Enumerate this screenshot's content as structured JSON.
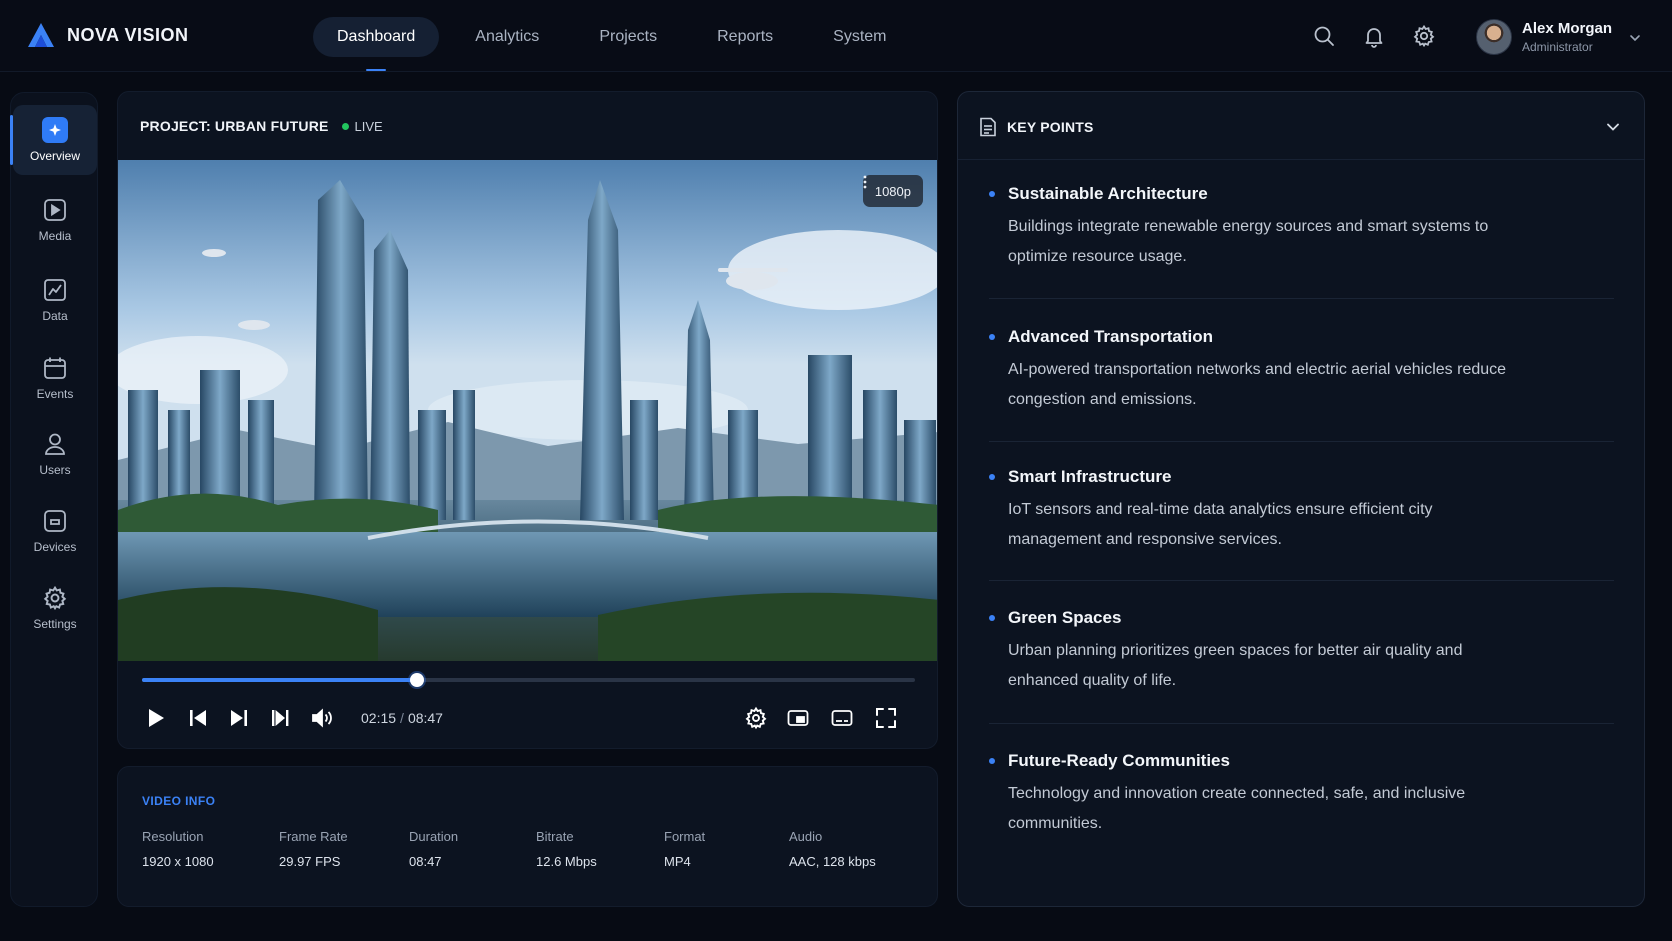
{
  "brand": {
    "name": "NOVA VISION"
  },
  "nav": {
    "tabs": [
      "Dashboard",
      "Analytics",
      "Projects",
      "Reports",
      "System"
    ],
    "active": "Dashboard"
  },
  "user": {
    "name": "Alex Morgan",
    "role": "Administrator"
  },
  "sidebar": {
    "items": [
      "Overview",
      "Media",
      "Data",
      "Events",
      "Users",
      "Devices",
      "Settings"
    ],
    "active": "Overview"
  },
  "player": {
    "project_title": "PROJECT: URBAN FUTURE",
    "status": "LIVE",
    "resolution_badge": "1080p",
    "current_time": "02:15",
    "time_separator": "/",
    "total_time": "08:47",
    "progress": 0.356
  },
  "video_info": {
    "title": "VIDEO INFO",
    "fields": [
      {
        "label": "Resolution",
        "value": "1920 x 1080"
      },
      {
        "label": "Frame Rate",
        "value": "29.97 FPS"
      },
      {
        "label": "Duration",
        "value": "08:47"
      },
      {
        "label": "Bitrate",
        "value": "12.6 Mbps"
      },
      {
        "label": "Format",
        "value": "MP4"
      },
      {
        "label": "Audio",
        "value": "AAC, 128 kbps"
      }
    ]
  },
  "key_points": {
    "title": "KEY POINTS",
    "items": [
      {
        "heading": "Sustainable Architecture",
        "body": "Buildings integrate renewable energy sources and smart systems to optimize resource usage."
      },
      {
        "heading": "Advanced Transportation",
        "body": "AI-powered transportation networks and electric aerial vehicles reduce congestion and emissions."
      },
      {
        "heading": "Smart Infrastructure",
        "body": "IoT sensors and real-time data analytics ensure efficient city management and responsive services."
      },
      {
        "heading": "Green Spaces",
        "body": "Urban planning prioritizes green spaces for better air quality and enhanced quality of life."
      },
      {
        "heading": "Future-Ready Communities",
        "body": "Technology and innovation create connected, safe, and inclusive communities."
      }
    ]
  },
  "colors": {
    "accent": "#3b82f6",
    "live": "#22c55e",
    "background": "#070b14",
    "panel": "#0c1320"
  }
}
